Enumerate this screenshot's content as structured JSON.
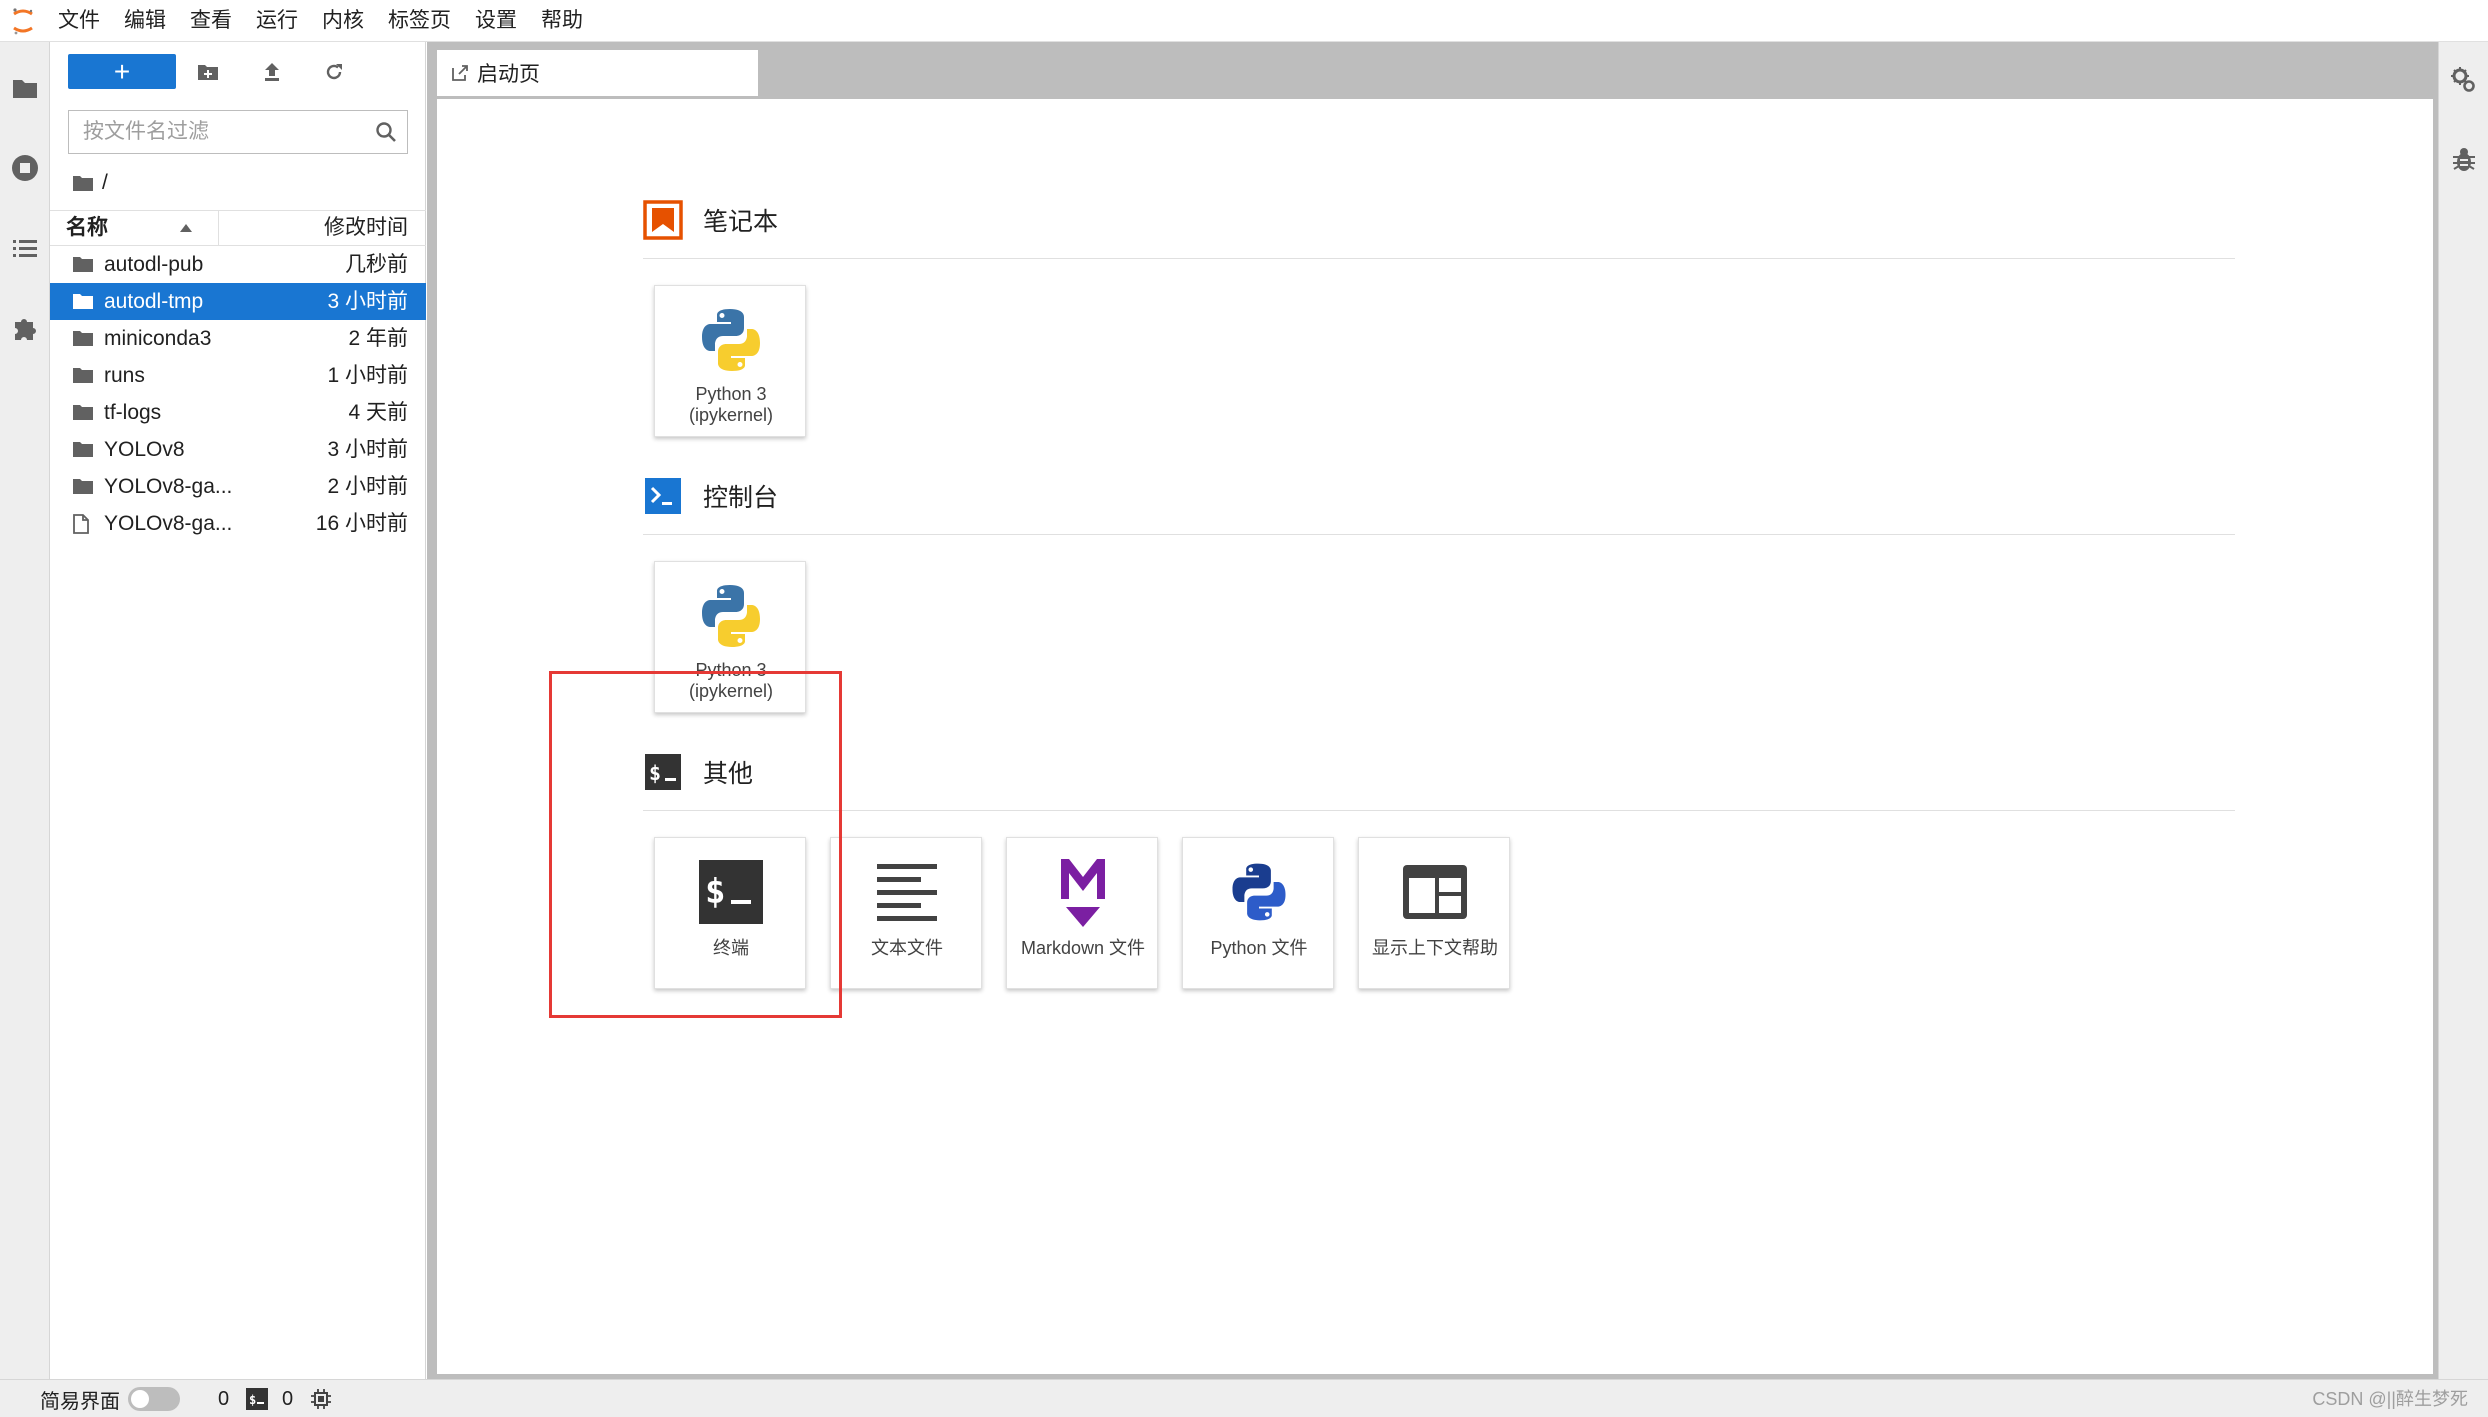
{
  "menu": {
    "items": [
      "文件",
      "编辑",
      "查看",
      "运行",
      "内核",
      "标签页",
      "设置",
      "帮助"
    ]
  },
  "filebrowser": {
    "new_label": "+",
    "filter_placeholder": "按文件名过滤",
    "breadcrumb": "/",
    "col_name": "名称",
    "col_modified": "修改时间",
    "rows": [
      {
        "name": "autodl-pub",
        "time": "几秒前",
        "type": "folder"
      },
      {
        "name": "autodl-tmp",
        "time": "3 小时前",
        "type": "folder",
        "selected": true
      },
      {
        "name": "miniconda3",
        "time": "2 年前",
        "type": "folder"
      },
      {
        "name": "runs",
        "time": "1 小时前",
        "type": "folder"
      },
      {
        "name": "tf-logs",
        "time": "4 天前",
        "type": "folder"
      },
      {
        "name": "YOLOv8",
        "time": "3 小时前",
        "type": "folder"
      },
      {
        "name": "YOLOv8-ga...",
        "time": "2 小时前",
        "type": "folder"
      },
      {
        "name": "YOLOv8-ga...",
        "time": "16 小时前",
        "type": "file"
      }
    ]
  },
  "tab": {
    "label": "启动页"
  },
  "launcher": {
    "notebook": {
      "title": "笔记本",
      "cards": [
        {
          "label_line1": "Python 3",
          "label_line2": "(ipykernel)"
        }
      ]
    },
    "console": {
      "title": "控制台",
      "cards": [
        {
          "label_line1": "Python 3",
          "label_line2": "(ipykernel)"
        }
      ]
    },
    "other": {
      "title": "其他",
      "cards": [
        {
          "label": "终端"
        },
        {
          "label": "文本文件"
        },
        {
          "label": "Markdown 文件"
        },
        {
          "label": "Python 文件"
        },
        {
          "label": "显示上下文帮助"
        }
      ]
    }
  },
  "statusbar": {
    "simple_mode": "简易界面",
    "kernels_count": "0",
    "terminals_count": "0",
    "watermark": "CSDN @||醉生梦死"
  },
  "colors": {
    "accent": "#1976d2",
    "highlight": "#e53935",
    "notebook_orange": "#e65100",
    "markdown_purple": "#7b1fa2"
  }
}
